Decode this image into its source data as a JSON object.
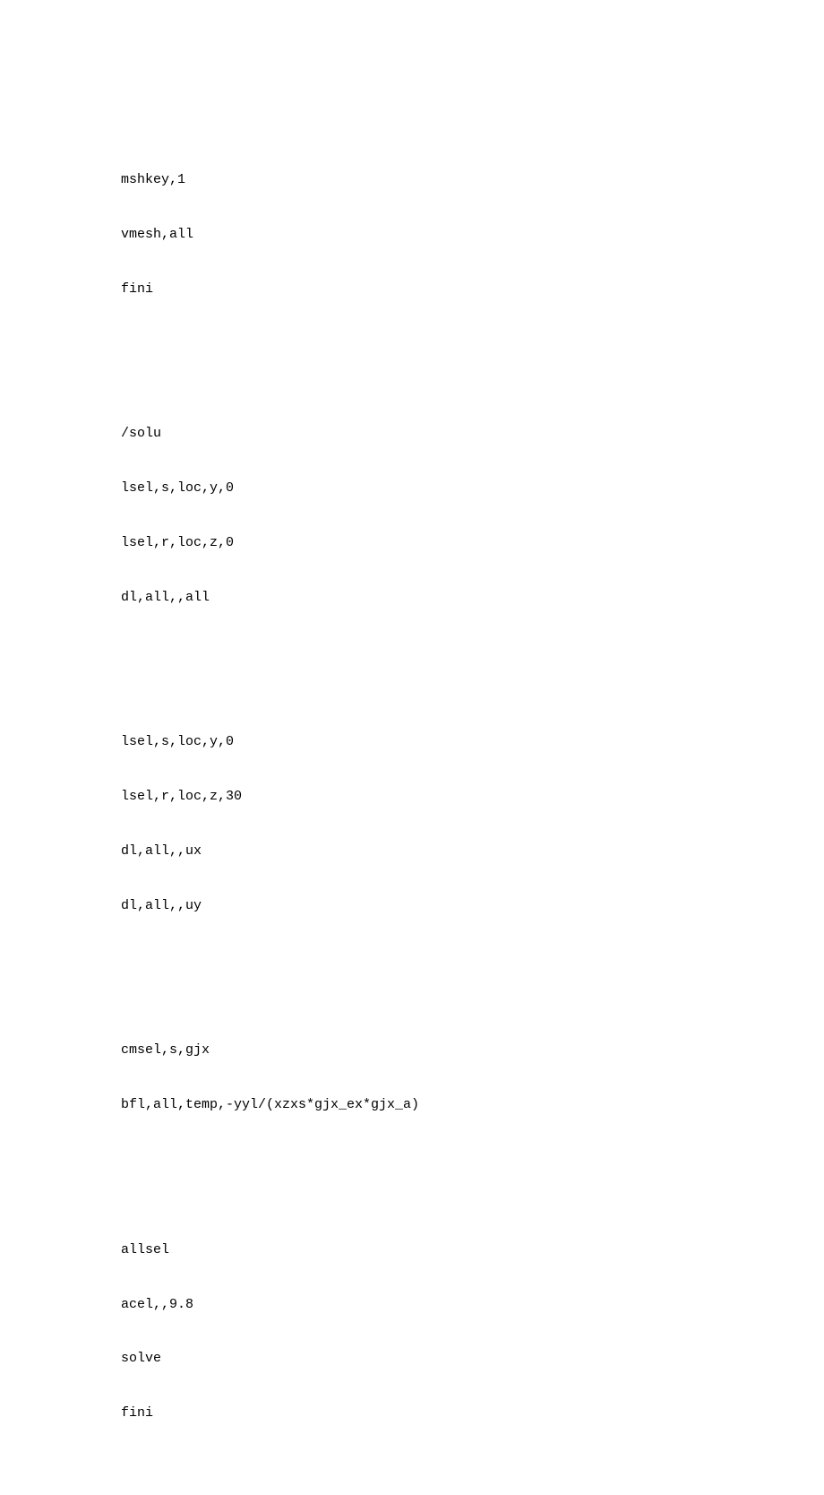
{
  "code": {
    "block1": {
      "l1": "mshkey,1",
      "l2": "vmesh,all",
      "l3": "fini"
    },
    "block2": {
      "l1": "/solu",
      "l2": "lsel,s,loc,y,0",
      "l3": "lsel,r,loc,z,0",
      "l4": "dl,all,,all"
    },
    "block3": {
      "l1": "lsel,s,loc,y,0",
      "l2": "lsel,r,loc,z,30",
      "l3": "dl,all,,ux",
      "l4": "dl,all,,uy"
    },
    "block4": {
      "l1": "cmsel,s,gjx",
      "l2": "bfl,all,temp,-yyl/(xzxs*gjx_ex*gjx_a)"
    },
    "block5": {
      "l1": "allsel",
      "l2": "acel,,9.8",
      "l3": "solve",
      "l4": "fini"
    }
  }
}
